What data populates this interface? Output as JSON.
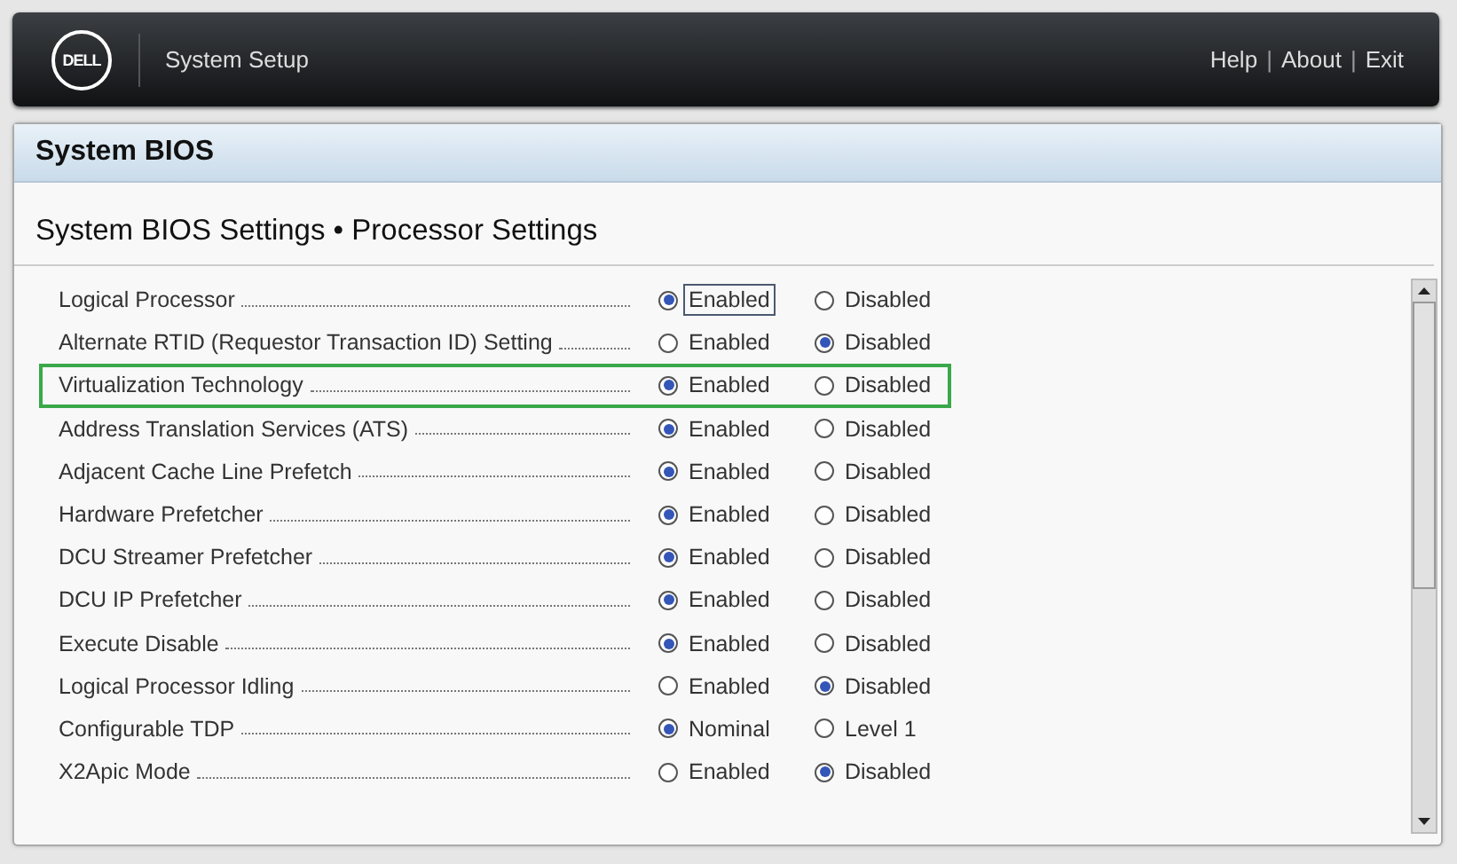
{
  "header": {
    "logo": "DELL",
    "title": "System Setup",
    "links": [
      "Help",
      "About",
      "Exit"
    ],
    "link_separator": "|"
  },
  "panel": {
    "title": "System BIOS",
    "breadcrumb": "System BIOS Settings • Processor Settings"
  },
  "settings": [
    {
      "label": "Logical Processor",
      "highlighted": false,
      "options": [
        {
          "label": "Enabled",
          "selected": true,
          "focused": true
        },
        {
          "label": "Disabled",
          "selected": false,
          "focused": false
        }
      ]
    },
    {
      "label": "Alternate RTID (Requestor Transaction ID) Setting",
      "highlighted": false,
      "options": [
        {
          "label": "Enabled",
          "selected": false,
          "focused": false
        },
        {
          "label": "Disabled",
          "selected": true,
          "focused": false
        }
      ]
    },
    {
      "label": "Virtualization Technology",
      "highlighted": true,
      "options": [
        {
          "label": "Enabled",
          "selected": true,
          "focused": false
        },
        {
          "label": "Disabled",
          "selected": false,
          "focused": false
        }
      ]
    },
    {
      "label": "Address Translation Services (ATS)",
      "highlighted": false,
      "options": [
        {
          "label": "Enabled",
          "selected": true,
          "focused": false
        },
        {
          "label": "Disabled",
          "selected": false,
          "focused": false
        }
      ]
    },
    {
      "label": "Adjacent Cache Line Prefetch",
      "highlighted": false,
      "options": [
        {
          "label": "Enabled",
          "selected": true,
          "focused": false
        },
        {
          "label": "Disabled",
          "selected": false,
          "focused": false
        }
      ]
    },
    {
      "label": "Hardware Prefetcher",
      "highlighted": false,
      "options": [
        {
          "label": "Enabled",
          "selected": true,
          "focused": false
        },
        {
          "label": "Disabled",
          "selected": false,
          "focused": false
        }
      ]
    },
    {
      "label": "DCU Streamer Prefetcher",
      "highlighted": false,
      "options": [
        {
          "label": "Enabled",
          "selected": true,
          "focused": false
        },
        {
          "label": "Disabled",
          "selected": false,
          "focused": false
        }
      ]
    },
    {
      "label": "DCU IP Prefetcher",
      "highlighted": false,
      "options": [
        {
          "label": "Enabled",
          "selected": true,
          "focused": false
        },
        {
          "label": "Disabled",
          "selected": false,
          "focused": false
        }
      ]
    },
    {
      "label": "Execute Disable",
      "highlighted": false,
      "options": [
        {
          "label": "Enabled",
          "selected": true,
          "focused": false
        },
        {
          "label": "Disabled",
          "selected": false,
          "focused": false
        }
      ]
    },
    {
      "label": "Logical Processor Idling",
      "highlighted": false,
      "options": [
        {
          "label": "Enabled",
          "selected": false,
          "focused": false
        },
        {
          "label": "Disabled",
          "selected": true,
          "focused": false
        }
      ]
    },
    {
      "label": "Configurable TDP",
      "highlighted": false,
      "options": [
        {
          "label": "Nominal",
          "selected": true,
          "focused": false
        },
        {
          "label": "Level 1",
          "selected": false,
          "focused": false
        }
      ]
    },
    {
      "label": "X2Apic Mode",
      "highlighted": false,
      "options": [
        {
          "label": "Enabled",
          "selected": false,
          "focused": false
        },
        {
          "label": "Disabled",
          "selected": true,
          "focused": false
        }
      ]
    }
  ]
}
